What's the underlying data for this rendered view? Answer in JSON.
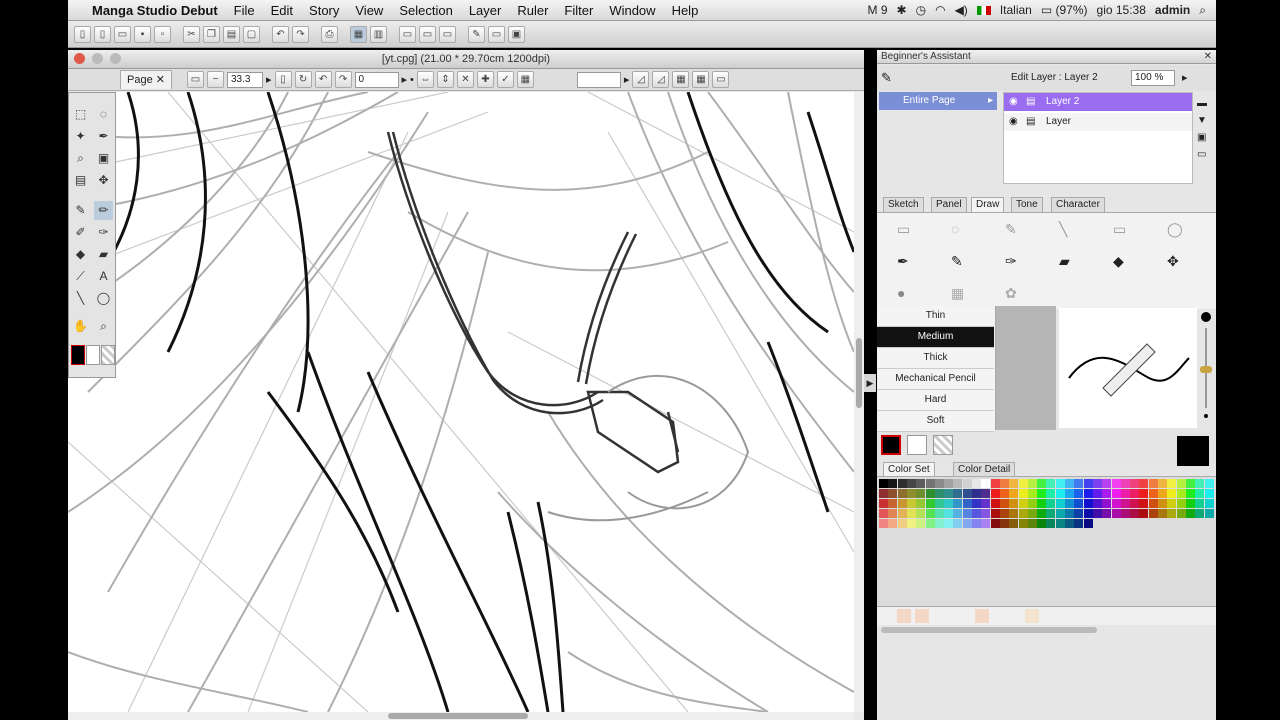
{
  "menubar": {
    "app_name": "Manga Studio Debut",
    "items": [
      "File",
      "Edit",
      "Story",
      "View",
      "Selection",
      "Layer",
      "Ruler",
      "Filter",
      "Window",
      "Help"
    ],
    "status": {
      "notif": "9",
      "language": "Italian",
      "battery": "(97%)",
      "clock": "gio 15:38",
      "user": "admin"
    }
  },
  "document": {
    "title": "[yt.cpg] (21.00 * 29.70cm 1200dpi)",
    "page_tab": "Page",
    "zoom": "33.3",
    "rotation": "0"
  },
  "assistant": {
    "title": "Beginner's Assistant",
    "edit_layer": "Edit Layer : Layer 2",
    "opacity": "100 %",
    "target": "Entire Page",
    "layers": [
      {
        "name": "Layer 2",
        "selected": true
      },
      {
        "name": "Layer",
        "selected": false
      }
    ],
    "tool_tabs": [
      "Sketch",
      "Panel",
      "Draw",
      "Tone",
      "Character"
    ],
    "active_tab": "Draw",
    "brushes": [
      "Thin",
      "Medium",
      "Thick",
      "Mechanical Pencil",
      "Hard",
      "Soft"
    ],
    "selected_brush": "Medium",
    "color_tabs": [
      "Color Set",
      "Color Detail"
    ]
  },
  "colors": {
    "selected": "#9a6cf0",
    "main_color": "#000000"
  }
}
